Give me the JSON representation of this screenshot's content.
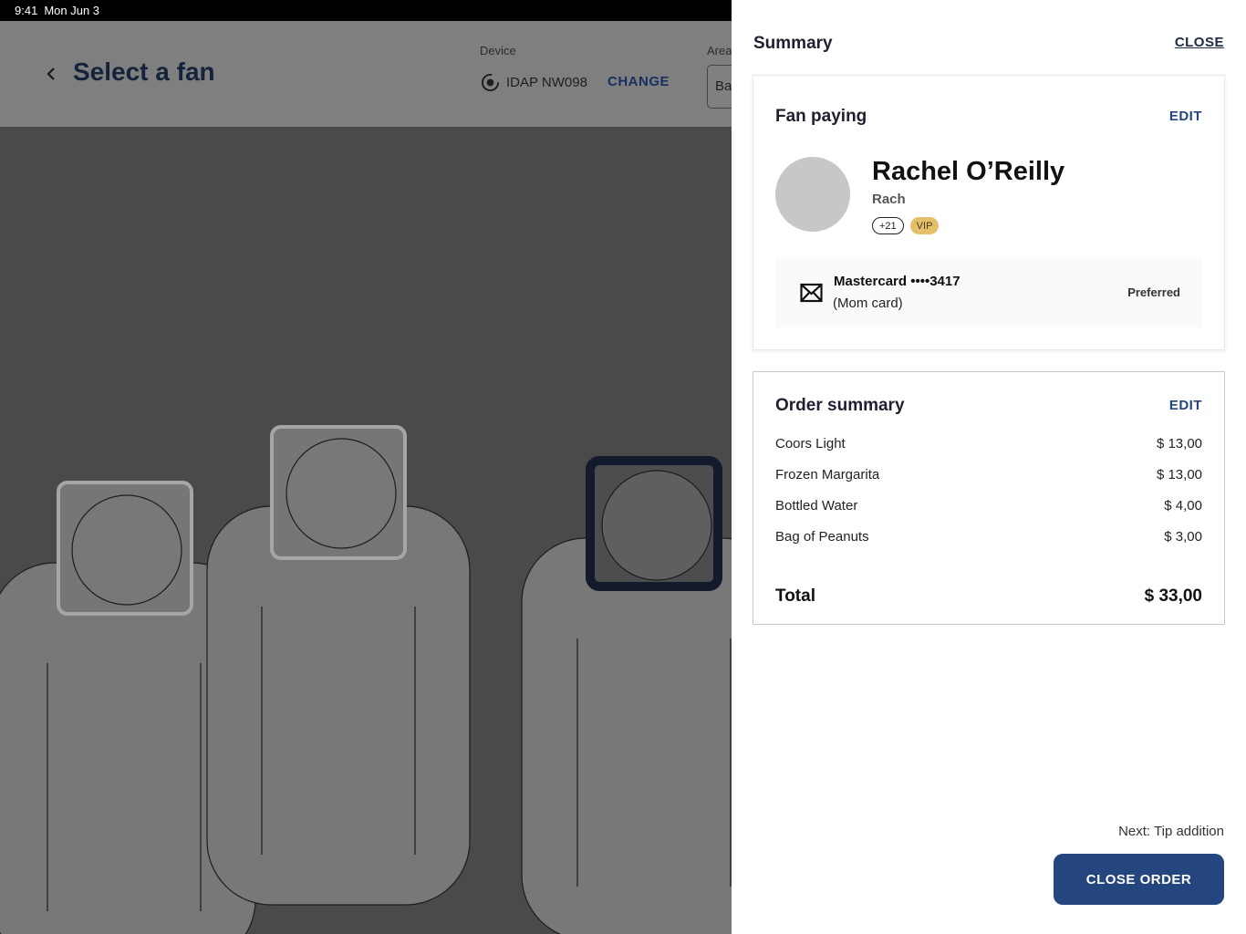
{
  "status_bar": {
    "time": "9:41",
    "date": "Mon Jun 3"
  },
  "background": {
    "back_icon": "chevron-left-icon",
    "title": "Select a fan",
    "device": {
      "label": "Device",
      "name": "IDAP NW098",
      "icon": "sync-icon",
      "change_label": "CHANGE"
    },
    "area": {
      "label": "Area",
      "value": "Ba"
    },
    "faces_detected": 3,
    "selected_face": 3
  },
  "summary": {
    "title": "Summary",
    "close_label": "CLOSE",
    "fan_paying": {
      "title": "Fan paying",
      "edit_label": "EDIT",
      "name": "Rachel O’Reilly",
      "nickname": "Rach",
      "badges": [
        "+21",
        "VIP"
      ],
      "payment": {
        "icon": "card-envelope-icon",
        "method": "Mastercard ••••3417",
        "note": "(Mom card)",
        "status": "Preferred"
      }
    },
    "order": {
      "title": "Order summary",
      "edit_label": "EDIT",
      "items": [
        {
          "name": "Coors Light",
          "price": "$ 13,00"
        },
        {
          "name": "Frozen Margarita",
          "price": "$ 13,00"
        },
        {
          "name": "Bottled Water",
          "price": "$ 4,00"
        },
        {
          "name": "Bag of Peanuts",
          "price": "$ 3,00"
        }
      ],
      "total_label": "Total",
      "total_value": "$ 33,00"
    },
    "next_label": "Next: Tip addition",
    "close_order_label": "CLOSE ORDER"
  },
  "colors": {
    "primary": "#24457d",
    "vip_badge": "#e4c06b",
    "overlay": "#4a4a4a",
    "selected_face_border": "#121a2c"
  }
}
